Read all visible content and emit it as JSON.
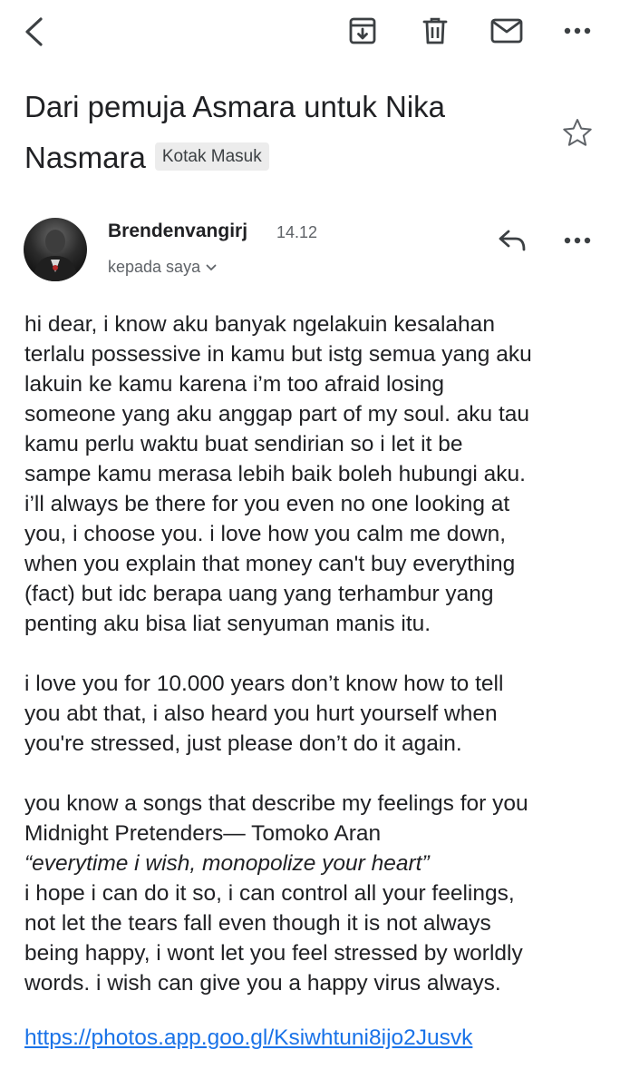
{
  "toolbar": {
    "back_icon": "back-arrow-icon",
    "archive_icon": "archive-icon",
    "delete_icon": "trash-icon",
    "mark_unread_icon": "mail-icon",
    "more_icon": "more-horizontal-icon"
  },
  "email": {
    "subject": "Dari pemuja Asmara untuk Nika Nasmara",
    "label": "Kotak Masuk",
    "sender": "Brendenvangirj",
    "time": "14.12",
    "recipient": "kepada saya",
    "body_lines": [
      "hi dear, i know aku banyak ngelakuin kesalahan",
      "terlalu possessive in kamu but istg semua yang aku",
      "lakuin ke kamu karena i’m too afraid losing",
      "someone yang aku anggap part of my soul. aku tau",
      "kamu perlu waktu buat sendirian so i let it be",
      "sampe kamu merasa lebih baik boleh hubungi aku.",
      "i’ll always be there for you even no one looking at",
      "you, i choose you. i love how you calm me down,",
      "when you explain that money can't buy everything",
      "(fact) but idc berapa uang yang terhambur yang",
      "penting aku bisa liat senyuman manis itu.",
      "",
      "i love you for 10.000 years don’t know how to tell",
      "you abt that, i also heard you hurt yourself when",
      "you're stressed, just please don’t do it again.",
      "",
      "you know a songs that describe my feelings for you",
      "Midnight Pretenders— Tomoko Aran",
      "“everytime i wish, monopolize your heart”",
      "i hope i can do it so, i can control all your feelings,",
      "not let the tears fall even though it is not always",
      "being happy, i wont let you feel stressed by worldly",
      "words. i wish can give you a happy virus always."
    ],
    "link": "https://photos.app.goo.gl/Ksiwhtuni8ijo2Jusvk"
  },
  "colors": {
    "link": "#1a73e8",
    "chip_bg": "#ececec",
    "icon": "#5f6368"
  }
}
